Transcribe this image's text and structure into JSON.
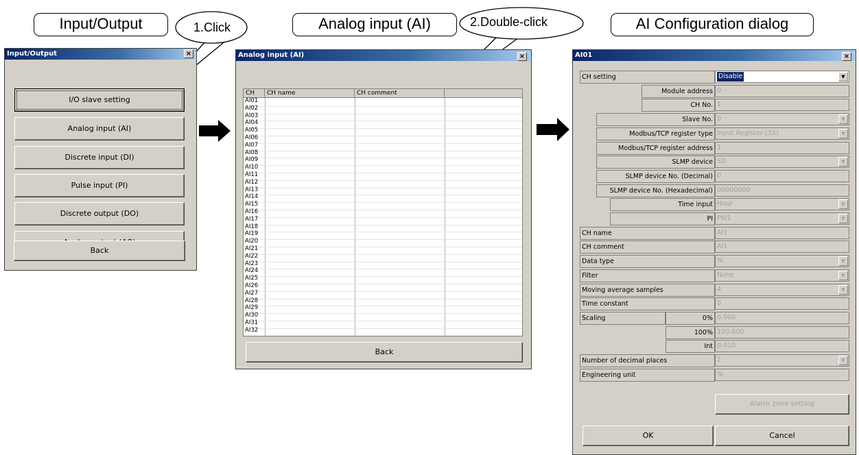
{
  "labels": {
    "input_output": "Input/Output",
    "analog_input": "Analog input (AI)",
    "ai_config": "AI Configuration dialog",
    "step1": "1.Click",
    "step2": "2.Double-click"
  },
  "io_window": {
    "title": "Input/Output",
    "close": "×",
    "buttons": [
      "I/O slave setting",
      "Analog input (AI)",
      "Discrete input (DI)",
      "Pulse input (PI)",
      "Discrete output (DO)",
      "Analog output (AO)"
    ],
    "back": "Back"
  },
  "ai_window": {
    "title": "Analog input (AI)",
    "close": "×",
    "columns": [
      "CH",
      "CH name",
      "CH comment"
    ],
    "rows": [
      "AI01",
      "AI02",
      "AI03",
      "AI04",
      "AI05",
      "AI06",
      "AI07",
      "AI08",
      "AI09",
      "AI10",
      "AI11",
      "AI12",
      "AI13",
      "AI14",
      "AI15",
      "AI16",
      "AI17",
      "AI18",
      "AI19",
      "AI20",
      "AI21",
      "AI22",
      "AI23",
      "AI24",
      "AI25",
      "AI26",
      "AI27",
      "AI28",
      "AI29",
      "AI30",
      "AI31",
      "AI32"
    ],
    "back": "Back"
  },
  "config_dialog": {
    "title": "AI01",
    "close": "×",
    "ch_setting_label": "CH setting",
    "ch_setting_value": "Disable",
    "fields": [
      {
        "label": "Module address",
        "value": "0"
      },
      {
        "label": "CH No.",
        "value": "1"
      },
      {
        "label": "Slave No.",
        "value": "0"
      },
      {
        "label": "Modbus/TCP register type",
        "value": "Input Register (3X)"
      },
      {
        "label": "Modbus/TCP register address",
        "value": "1"
      },
      {
        "label": "SLMP device",
        "value": "SD"
      },
      {
        "label": "SLMP device No. (Decimal)",
        "value": "0"
      },
      {
        "label": "SLMP device No. (Hexadecimal)",
        "value": "00000000"
      },
      {
        "label": "Time input",
        "value": "Hour"
      },
      {
        "label": "PI",
        "value": "PI01"
      },
      {
        "label": "CH name",
        "value": "AI1"
      },
      {
        "label": "CH comment",
        "value": "AI1"
      },
      {
        "label": "Data type",
        "value": "%"
      },
      {
        "label": "Filter",
        "value": "None"
      },
      {
        "label": "Moving average samples",
        "value": "4"
      },
      {
        "label": "Time constant",
        "value": "0"
      }
    ],
    "scaling_label": "Scaling",
    "scaling": [
      {
        "label": "0%",
        "value": "0.000"
      },
      {
        "label": "100%",
        "value": "100.000"
      },
      {
        "label": "Int",
        "value": "0.010"
      }
    ],
    "decimal_label": "Number of decimal places",
    "decimal_value": "2",
    "unit_label": "Engineering unit",
    "unit_value": "%",
    "alarm_button": "Alarm zone setting",
    "ok": "OK",
    "cancel": "Cancel",
    "dropdown_glyph": "▼"
  }
}
